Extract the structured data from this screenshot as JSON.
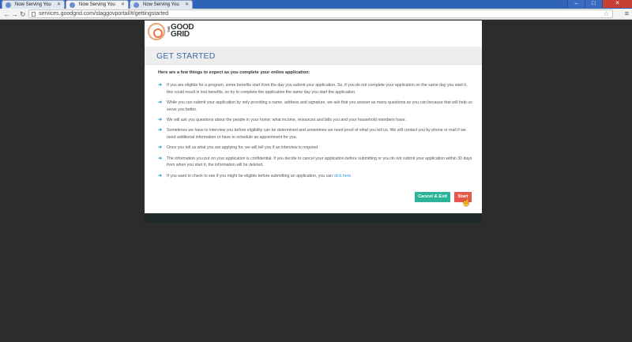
{
  "browser": {
    "tabs": [
      {
        "label": "Now Serving You",
        "active": false
      },
      {
        "label": "Now Serving You",
        "active": true
      },
      {
        "label": "Now Serving You",
        "active": false
      }
    ],
    "url": "services.goodgrid.com/staggovportal/#/gettingstarted",
    "back_icon": "back-arrow-icon",
    "forward_icon": "forward-arrow-icon",
    "reload_icon": "reload-icon"
  },
  "logo": {
    "small": "THE",
    "line1": "GOOD",
    "line2": "GRID"
  },
  "modal": {
    "title": "GET STARTED",
    "intro": "Here are a few things to expect as you complete your online application:",
    "items": [
      "If you are eligible for a program, some benefits start from the day you submit your application. So, if you do not complete your application on the same day you start it, this could result in lost benefits, so try to complete the application the same day you start the application.",
      "While you can submit your application by only providing a name, address and signature, we ask that you answer as many questions as you can because that will help us serve you better.",
      "We will ask you questions about the people in your home; what income, resources and bills you and your household members have.",
      "Sometimes we have to interview you before eligibility can be determined and sometimes we need proof of what you tell us. We will contact you by phone or mail if we need additional information or have to schedule an appointment for you.",
      "Once you tell us what you are applying for, we will tell you if an interview is required.",
      "The information you put on your application is confidential. If you decide to cancel your application before submitting or you do not submit your application within 30 days from when you start it, the information will be deleted."
    ],
    "last_item_text": "If you want to check to see if you might be eligible before submitting an application, you can ",
    "last_item_link": "click here",
    "last_item_end": ".",
    "cancel_label": "Cancel & Exit",
    "start_label": "Start"
  },
  "colors": {
    "accent_blue": "#3a6aa5",
    "arrow_blue": "#2a9fd6",
    "cancel_green": "#2bb39a",
    "start_red": "#e8574a"
  }
}
